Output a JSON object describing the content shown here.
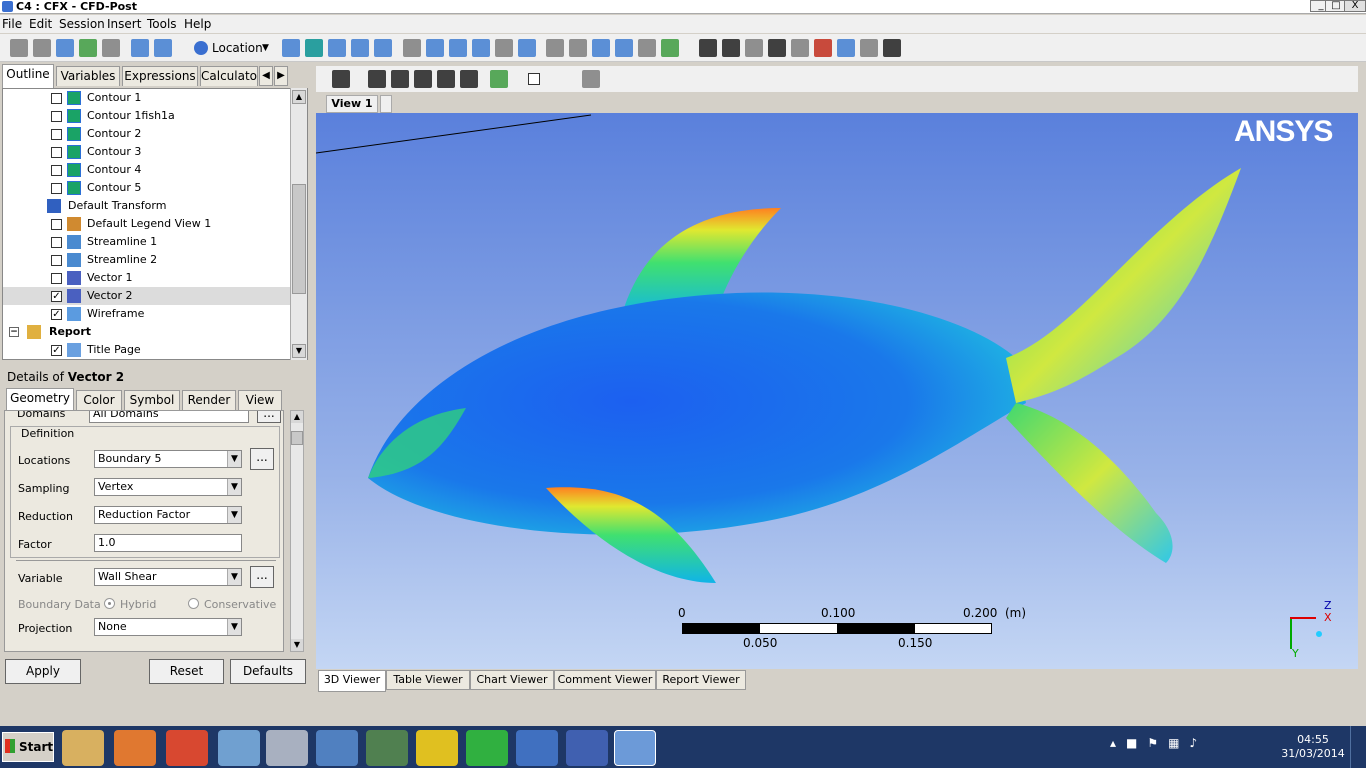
{
  "window": {
    "title": "C4 : CFX - CFD-Post",
    "controls": [
      "_",
      "□",
      "X"
    ]
  },
  "menu": [
    "File",
    "Edit",
    "Session",
    "Insert",
    "Tools",
    "Help"
  ],
  "toolbar": {
    "location_label": "Location"
  },
  "left_tabs": [
    "Outline",
    "Variables",
    "Expressions",
    "Calculato"
  ],
  "tree": [
    {
      "label": "Contour 1",
      "checked": false,
      "icon": "contour-icon"
    },
    {
      "label": "Contour 1fish1a",
      "checked": false,
      "icon": "contour-icon"
    },
    {
      "label": "Contour 2",
      "checked": false,
      "icon": "contour-icon"
    },
    {
      "label": "Contour 3",
      "checked": false,
      "icon": "contour-icon"
    },
    {
      "label": "Contour 4",
      "checked": false,
      "icon": "contour-icon"
    },
    {
      "label": "Contour 5",
      "checked": false,
      "icon": "contour-icon"
    },
    {
      "label": "Default Transform",
      "checked": null,
      "icon": "transform-icon"
    },
    {
      "label": "Default Legend View 1",
      "checked": false,
      "icon": "legend-icon"
    },
    {
      "label": "Streamline 1",
      "checked": false,
      "icon": "streamline-icon"
    },
    {
      "label": "Streamline 2",
      "checked": false,
      "icon": "streamline-icon"
    },
    {
      "label": "Vector 1",
      "checked": false,
      "icon": "vector-icon"
    },
    {
      "label": "Vector 2",
      "checked": true,
      "icon": "vector-icon",
      "selected": true
    },
    {
      "label": "Wireframe",
      "checked": true,
      "icon": "wireframe-icon"
    },
    {
      "label": "Report",
      "checked": null,
      "icon": "folder-icon",
      "bold": true
    },
    {
      "label": "Title Page",
      "checked": true,
      "icon": "page-icon"
    }
  ],
  "details": {
    "heading_prefix": "Details of ",
    "heading_object": "Vector 2",
    "tabs": [
      "Geometry",
      "Color",
      "Symbol",
      "Render",
      "View"
    ],
    "domains_label": "Domains",
    "domains_value": "All Domains",
    "group_title": "Definition",
    "locations_label": "Locations",
    "locations_value": "Boundary 5",
    "sampling_label": "Sampling",
    "sampling_value": "Vertex",
    "reduction_label": "Reduction",
    "reduction_value": "Reduction Factor",
    "factor_label": "Factor",
    "factor_value": "1.0",
    "variable_label": "Variable",
    "variable_value": "Wall Shear",
    "boundary_label": "Boundary Data",
    "hybrid_label": "Hybrid",
    "conservative_label": "Conservative",
    "projection_label": "Projection",
    "projection_value": "None",
    "ellipsis": "...",
    "apply": "Apply",
    "reset": "Reset",
    "defaults": "Defaults"
  },
  "viewer": {
    "tab": "View 1",
    "logo": "ANSYS",
    "scale": {
      "top": [
        "0",
        "0.100",
        "0.200"
      ],
      "unit": "(m)",
      "bottom": [
        "0.050",
        "0.150"
      ]
    },
    "axes": {
      "z": "Z",
      "x": "X",
      "y": "Y"
    },
    "bottom_tabs": [
      "3D Viewer",
      "Table Viewer",
      "Chart Viewer",
      "Comment Viewer",
      "Report Viewer"
    ]
  },
  "taskbar": {
    "start": "Start",
    "time": "04:55",
    "date": "31/03/2014"
  }
}
